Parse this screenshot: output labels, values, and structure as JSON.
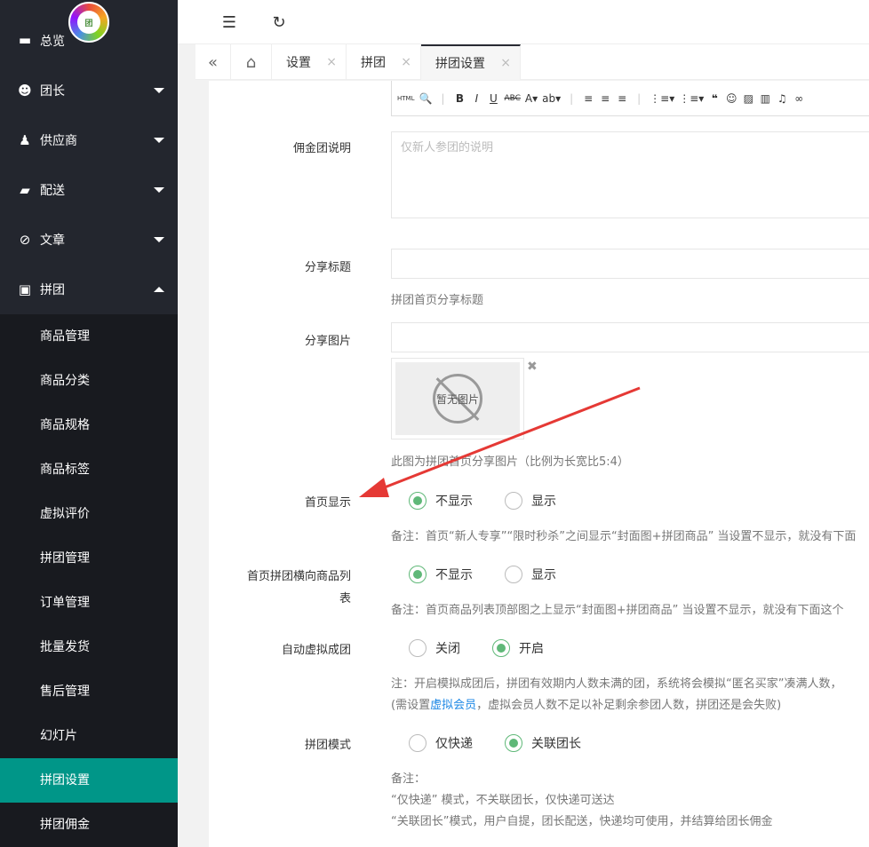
{
  "sidebar": {
    "top_partial_label": "总览",
    "items": [
      {
        "label": "团长",
        "icon": "user-icon"
      },
      {
        "label": "供应商",
        "icon": "supplier-icon"
      },
      {
        "label": "配送",
        "icon": "truck-icon"
      },
      {
        "label": "文章",
        "icon": "compass-icon"
      },
      {
        "label": "拼团",
        "icon": "group-buy-icon"
      }
    ],
    "submenu": [
      "商品管理",
      "商品分类",
      "商品规格",
      "商品标签",
      "虚拟评价",
      "拼团管理",
      "订单管理",
      "批量发货",
      "售后管理",
      "幻灯片",
      "拼团设置",
      "拼团佣金"
    ],
    "active_submenu": "拼团设置"
  },
  "tabs": [
    {
      "label": "设置"
    },
    {
      "label": "拼团"
    },
    {
      "label": "拼团设置"
    }
  ],
  "form": {
    "commission_label": "佣金团说明",
    "commission_placeholder": "仅新人参团的说明",
    "share_title_label": "分享标题",
    "share_title_help": "拼团首页分享标题",
    "share_image_label": "分享图片",
    "no_image_text": "暂无图片",
    "share_image_help": "此图为拼团首页分享图片（比例为长宽比5:4）",
    "home_display_label": "首页显示",
    "home_display_options": [
      "不显示",
      "显示"
    ],
    "home_display_selected": "不显示",
    "home_display_help": "备注：首页“新人专享”“限时秒杀”之间显示“封面图+拼团商品” 当设置不显示，就没有下面",
    "horizontal_label_line1": "首页拼团横向商品列",
    "horizontal_label_line2": "表",
    "horizontal_options": [
      "不显示",
      "显示"
    ],
    "horizontal_selected": "不显示",
    "horizontal_help": "备注：首页商品列表顶部图之上显示“封面图+拼团商品” 当设置不显示，就没有下面这个",
    "auto_virtual_label": "自动虚拟成团",
    "auto_virtual_options": [
      "关闭",
      "开启"
    ],
    "auto_virtual_selected": "开启",
    "auto_virtual_help_line1": "注：开启模拟成团后，拼团有效期内人数未满的团，系统将会模拟“匿名买家”凑满人数，",
    "auto_virtual_help_line2_pre": "(需设置",
    "auto_virtual_help_link": "虚拟会员",
    "auto_virtual_help_line2_post": "，虚拟会员人数不足以补足剩余参团人数，拼团还是会失败)",
    "mode_label": "拼团模式",
    "mode_options": [
      "仅快递",
      "关联团长"
    ],
    "mode_selected": "关联团长",
    "mode_help_line1": "备注：",
    "mode_help_line2": "“仅快递” 模式，不关联团长，仅快递可送达",
    "mode_help_line3": "“关联团长”模式，用户自提，团长配送，快递均可使用，并结算给团长佣金"
  },
  "colors": {
    "sidebar_bg": "#23262e",
    "active_green": "#009688",
    "radio_green": "#5fb878",
    "link_blue": "#1e88e5",
    "arrow_red": "#e53935"
  }
}
